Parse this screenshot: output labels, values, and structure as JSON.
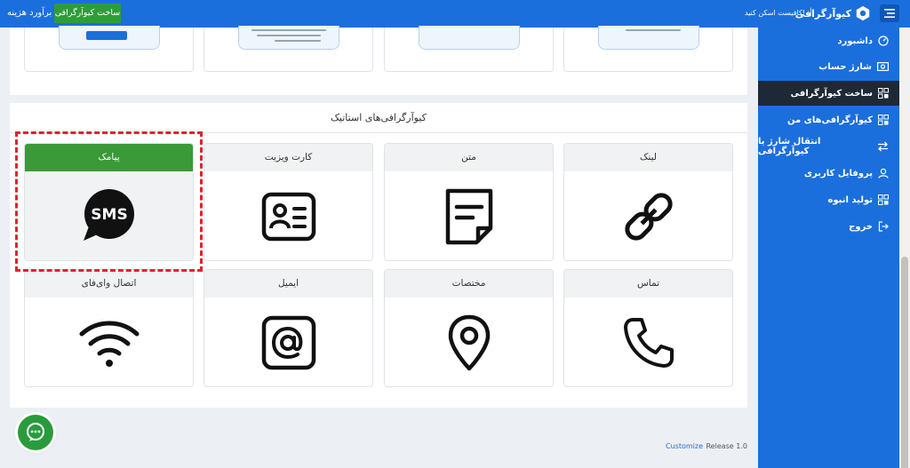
{
  "topbar": {
    "cost_label": "برآورد هزینه",
    "create_button": "ساخت کیوآرگرافی",
    "brand": "کیوآرگرافی",
    "separator": "|",
    "tagline": "کافیست اسکن کنید!"
  },
  "sidebar": {
    "items": [
      {
        "label": "داشبورد",
        "icon": "gauge-icon"
      },
      {
        "label": "شارژ حساب",
        "icon": "money-icon"
      },
      {
        "label": "ساخت کیوآرگرافی",
        "icon": "qr-grid-icon",
        "active": true
      },
      {
        "label": "کیوآرگرافی‌های من",
        "icon": "qr-grid-icon"
      },
      {
        "label": "انتقال شارژ یا کیوآرگرافی",
        "icon": "transfer-icon"
      },
      {
        "label": "پروفایل کاربری",
        "icon": "user-icon"
      },
      {
        "label": "تولید انبوه",
        "icon": "qr-grid-icon"
      },
      {
        "label": "خروج",
        "icon": "logout-icon"
      }
    ]
  },
  "section": {
    "title": "کیوآرگرافی‌های استاتیک",
    "cards": [
      {
        "label": "لینک",
        "icon": "link-icon"
      },
      {
        "label": "متن",
        "icon": "text-note-icon"
      },
      {
        "label": "کارت ویزیت",
        "icon": "business-card-icon"
      },
      {
        "label": "پیامک",
        "icon": "sms-icon",
        "selected": true
      },
      {
        "label": "تماس",
        "icon": "phone-icon"
      },
      {
        "label": "مختصات",
        "icon": "location-pin-icon"
      },
      {
        "label": "ایمیل",
        "icon": "email-at-icon"
      },
      {
        "label": "اتصال وای‌فای",
        "icon": "wifi-icon"
      }
    ]
  },
  "footer": {
    "release": "Release 1.0",
    "customize": "Customize"
  },
  "colors": {
    "primary": "#1b6fdc",
    "green": "#3a9a37",
    "sidebar_active": "#1e2937",
    "highlight": "#e3202e"
  }
}
